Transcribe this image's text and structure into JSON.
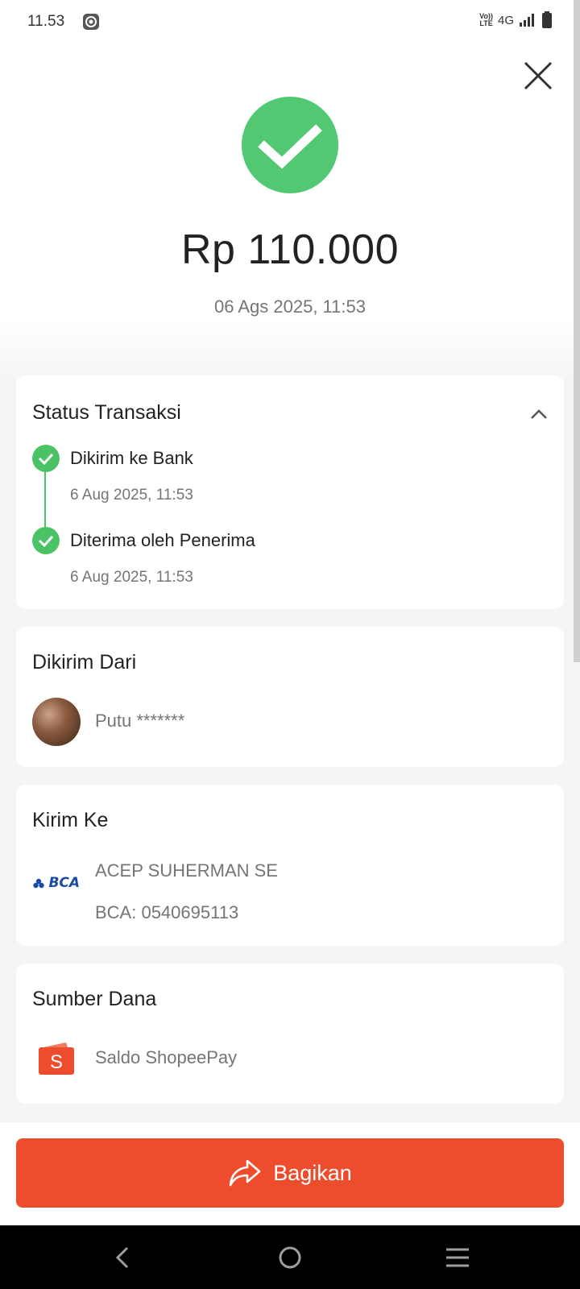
{
  "status_bar": {
    "time": "11.53",
    "volte_top": "Vo))",
    "volte_bottom": "LTE",
    "network": "4G"
  },
  "header": {
    "amount": "Rp 110.000",
    "date": "06 Ags 2025, 11:53"
  },
  "status_section": {
    "title": "Status Transaksi",
    "steps": [
      {
        "label": "Dikirim ke Bank",
        "time": "6 Aug 2025, 11:53"
      },
      {
        "label": "Diterima oleh Penerima",
        "time": "6 Aug 2025, 11:53"
      }
    ]
  },
  "sender_section": {
    "title": "Dikirim Dari",
    "name": "Putu *******"
  },
  "recipient_section": {
    "title": "Kirim Ke",
    "bank_logo_text": "BCA",
    "name": "ACEP SUHERMAN SE",
    "account": "BCA: 0540695113"
  },
  "source_section": {
    "title": "Sumber Dana",
    "source": "Saldo ShopeePay",
    "wallet_letter": "S"
  },
  "share_button": {
    "label": "Bagikan"
  },
  "colors": {
    "accent": "#ee4d2d",
    "success": "#52c873",
    "timeline": "#4cc266",
    "bca_blue": "#1a4aa5"
  },
  "icons": [
    "close-icon",
    "check-icon",
    "chevron-up-icon",
    "bca-logo-icon",
    "shopeepay-wallet-icon",
    "share-icon",
    "back-icon",
    "home-icon",
    "menu-icon"
  ]
}
